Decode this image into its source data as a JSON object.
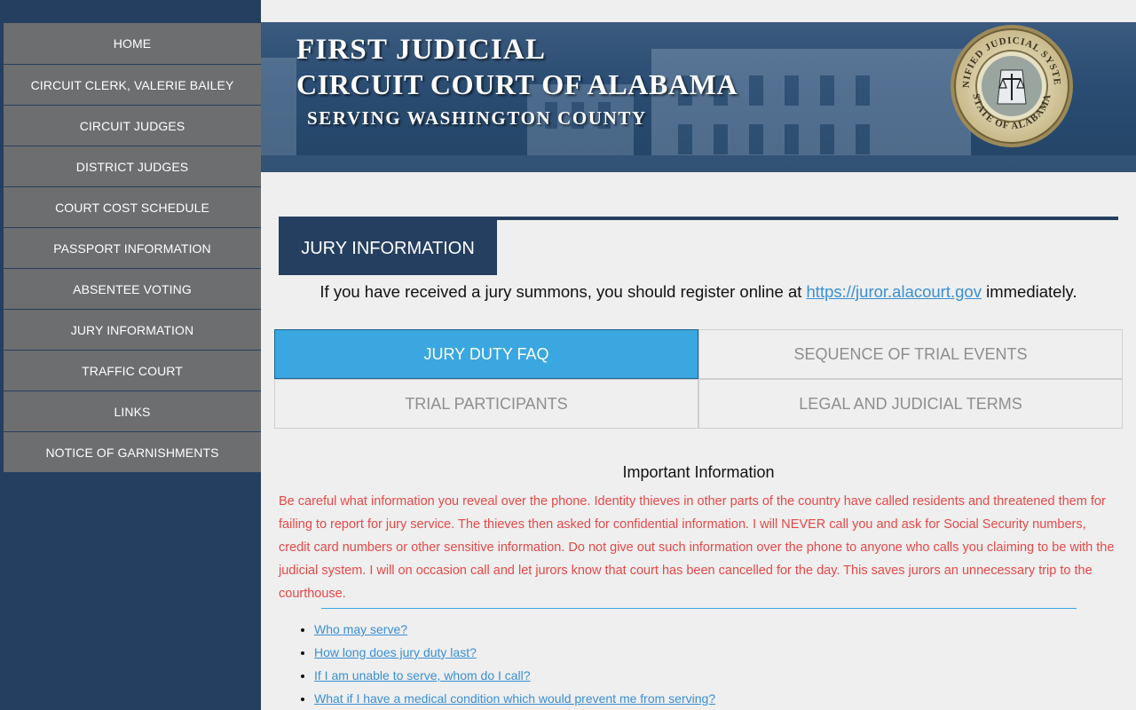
{
  "nav": {
    "items": [
      {
        "label": "HOME"
      },
      {
        "label": "CIRCUIT CLERK, VALERIE BAILEY"
      },
      {
        "label": "CIRCUIT JUDGES"
      },
      {
        "label": "DISTRICT JUDGES"
      },
      {
        "label": "COURT COST SCHEDULE"
      },
      {
        "label": "PASSPORT INFORMATION"
      },
      {
        "label": "ABSENTEE VOTING"
      },
      {
        "label": "JURY INFORMATION"
      },
      {
        "label": "TRAFFIC COURT"
      },
      {
        "label": "LINKS"
      },
      {
        "label": "NOTICE OF GARNISHMENTS"
      }
    ]
  },
  "banner": {
    "line1": "FIRST JUDICIAL",
    "line2": "CIRCUIT COURT OF ALABAMA",
    "line3": "SERVING WASHINGTON COUNTY",
    "seal_icon": "court-seal-icon",
    "seal_top": "UNIFIED JUDICIAL SYSTEM",
    "seal_bottom": "STATE OF ALABAMA"
  },
  "section": {
    "title": "JURY INFORMATION"
  },
  "summons": {
    "before": "If you have received a jury summons, you should register online at ",
    "link": "https://juror.alacourt.gov",
    "after": " immediately."
  },
  "tabs": [
    {
      "label": "JURY DUTY FAQ",
      "active": true
    },
    {
      "label": "SEQUENCE OF TRIAL EVENTS",
      "active": false
    },
    {
      "label": "TRIAL PARTICIPANTS",
      "active": false
    },
    {
      "label": "LEGAL AND JUDICIAL TERMS",
      "active": false
    }
  ],
  "important": {
    "title": "Important Information",
    "text": "Be careful what information you reveal over the phone. Identity thieves in other parts of the country have called residents and threatened them for failing to report for jury service. The thieves then asked for confidential information. I will NEVER call you and ask for Social Security numbers, credit card numbers or other sensitive information. Do not give out such information over the phone to anyone who calls you claiming to be with the judicial system. I will on occasion call and let jurors know that court has been cancelled for the day. This saves jurors an unnecessary trip to the courthouse."
  },
  "faq": [
    {
      "q": "Who may serve?"
    },
    {
      "q": "How long does jury duty last?"
    },
    {
      "q": "If I am unable to serve, whom do I call?"
    },
    {
      "q": "What if I have a medical condition which would prevent me from serving?"
    }
  ],
  "colors": {
    "navy": "#243f5f",
    "nav_gray": "#6d6e70",
    "accent_blue": "#3aa7e0",
    "warning_red": "#e84848"
  }
}
